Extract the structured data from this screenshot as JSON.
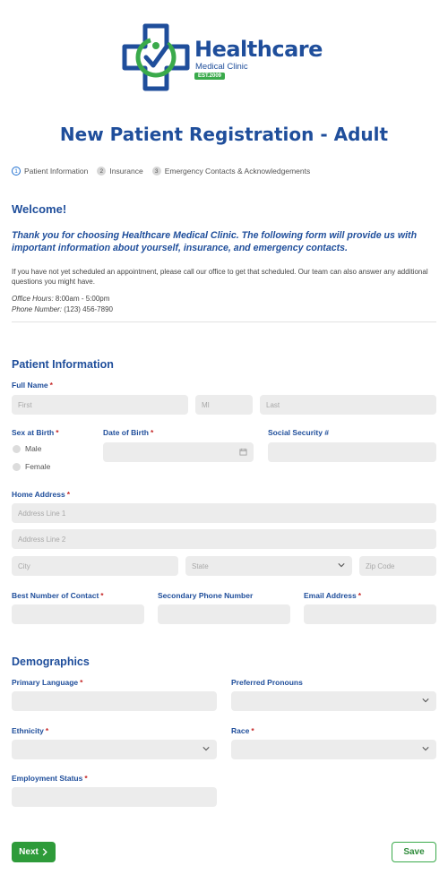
{
  "brand": {
    "name": "Healthcare",
    "subtitle": "Medical Clinic",
    "est": "EST.2009",
    "colors": {
      "blue": "#1f4e9b",
      "green": "#3aaa4b"
    }
  },
  "page_title": "New Patient Registration - Adult",
  "steps": [
    {
      "num": "1",
      "label": "Patient Information",
      "active": true
    },
    {
      "num": "2",
      "label": "Insurance",
      "active": false
    },
    {
      "num": "3",
      "label": "Emergency Contacts & Acknowledgements",
      "active": false
    }
  ],
  "welcome": {
    "heading": "Welcome!",
    "intro": "Thank you for choosing Healthcare Medical Clinic.  The following form will provide us with important information about yourself, insurance, and emergency contacts.",
    "note": "If you have not yet scheduled an appointment, please call our office to get that scheduled. Our team can also answer any additional questions you might have.",
    "hours_label": "Office Hours:",
    "hours_value": "8:00am - 5:00pm",
    "phone_label": "Phone Number:",
    "phone_value": "(123) 456-7890"
  },
  "patient_info": {
    "heading": "Patient Information",
    "full_name_label": "Full Name",
    "first_placeholder": "First",
    "mi_placeholder": "MI",
    "last_placeholder": "Last",
    "sex_label": "Sex at Birth",
    "sex_options": [
      "Male",
      "Female"
    ],
    "dob_label": "Date of Birth",
    "ssn_label": "Social Security #",
    "address_label": "Home Address",
    "address1_placeholder": "Address Line 1",
    "address2_placeholder": "Address Line 2",
    "city_placeholder": "City",
    "state_placeholder": "State",
    "zip_placeholder": "Zip Code",
    "best_number_label": "Best Number of Contact",
    "secondary_phone_label": "Secondary Phone Number",
    "email_label": "Email Address"
  },
  "demographics": {
    "heading": "Demographics",
    "primary_language_label": "Primary Language",
    "pronouns_label": "Preferred Pronouns",
    "ethnicity_label": "Ethnicity",
    "race_label": "Race",
    "employment_label": "Employment Status"
  },
  "required_mark": "*",
  "buttons": {
    "next": "Next",
    "next_icon": "chevron-right",
    "save": "Save"
  }
}
